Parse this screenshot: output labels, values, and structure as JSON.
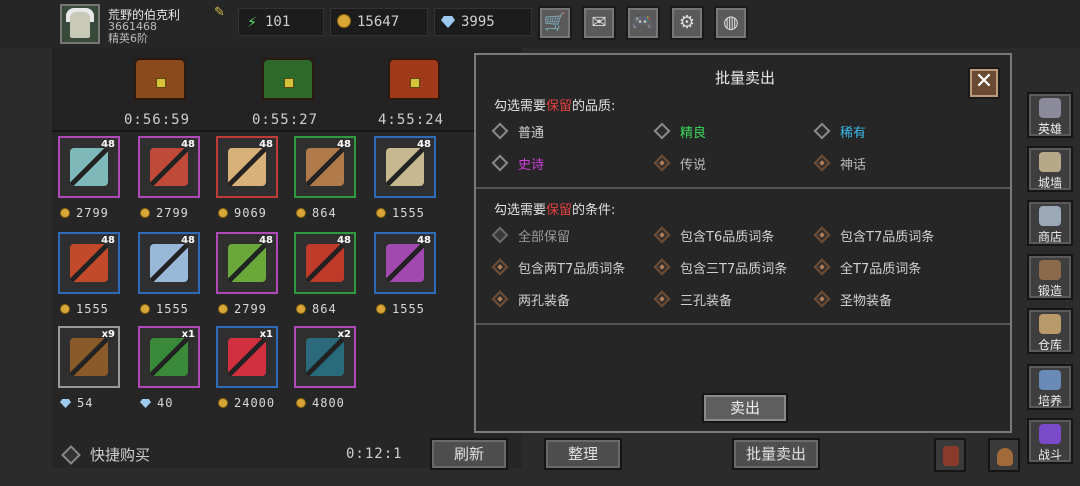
{
  "player": {
    "name": "荒野的伯克利",
    "id": "3661468",
    "rank": "精英6阶"
  },
  "resources": [
    {
      "icon": "energy-icon",
      "value": "101"
    },
    {
      "icon": "gold-coin-icon",
      "value": "15647"
    },
    {
      "icon": "diamond-icon",
      "value": "3995"
    }
  ],
  "top_buttons": [
    {
      "name": "shop-cart-icon",
      "glyph": "🛒"
    },
    {
      "name": "mail-icon",
      "glyph": "✉"
    },
    {
      "name": "gamepad-icon",
      "glyph": "🎮"
    },
    {
      "name": "settings-gear-icon",
      "glyph": "⚙"
    },
    {
      "name": "color-wheel-icon",
      "glyph": "◍"
    }
  ],
  "chests": [
    {
      "time": "0:56:59",
      "color": "#8a4a1c"
    },
    {
      "time": "0:55:27",
      "color": "#2d6a2a"
    },
    {
      "time": "4:55:24",
      "color": "#a03a1a"
    }
  ],
  "items": [
    {
      "qty": "48",
      "price": "2799",
      "currency": "coin",
      "border": "#b04ab8",
      "color": "#7fb8b8"
    },
    {
      "qty": "48",
      "price": "2799",
      "currency": "coin",
      "border": "#b04ab8",
      "color": "#c04a3a"
    },
    {
      "qty": "48",
      "price": "9069",
      "currency": "coin",
      "border": "#c03a3a",
      "color": "#d8b07a"
    },
    {
      "qty": "48",
      "price": "864",
      "currency": "coin",
      "border": "#2e9a3e",
      "color": "#b07a4a"
    },
    {
      "qty": "48",
      "price": "1555",
      "currency": "coin",
      "border": "#2e6ab8",
      "color": "#c8b890"
    },
    {
      "qty": "48",
      "price": "1555",
      "currency": "coin",
      "border": "#2e6ab8",
      "color": "#c04a2a"
    },
    {
      "qty": "48",
      "price": "1555",
      "currency": "coin",
      "border": "#2e6ab8",
      "color": "#9ab8d8"
    },
    {
      "qty": "48",
      "price": "2799",
      "currency": "coin",
      "border": "#b04ab8",
      "color": "#6aa83a"
    },
    {
      "qty": "48",
      "price": "864",
      "currency": "coin",
      "border": "#2e9a3e",
      "color": "#c03a2a"
    },
    {
      "qty": "48",
      "price": "1555",
      "currency": "coin",
      "border": "#2e6ab8",
      "color": "#a04ab0"
    },
    {
      "qty": "x9",
      "price": "54",
      "currency": "gem",
      "border": "#9a9a9a",
      "color": "#8a5a2a"
    },
    {
      "qty": "x1",
      "price": "40",
      "currency": "gem",
      "border": "#b04ab8",
      "color": "#3a8a3a"
    },
    {
      "qty": "x1",
      "price": "24000",
      "currency": "coin",
      "border": "#2e6ab8",
      "color": "#d03040"
    },
    {
      "qty": "x2",
      "price": "4800",
      "currency": "coin",
      "border": "#b04ab8",
      "color": "#2a6a7a"
    }
  ],
  "bottom": {
    "quick_buy": "快捷购买",
    "timer": "0:12:1",
    "refresh": "刷新",
    "sort": "整理",
    "bulk_sell": "批量卖出"
  },
  "modal": {
    "title": "批量卖出",
    "close": "✕",
    "quality_header_pre": "勾选需要",
    "quality_header_red": "保留",
    "quality_header_post": "的品质:",
    "qualities": [
      {
        "label": "普通",
        "color": "#d0d0d0",
        "state": "off"
      },
      {
        "label": "精良",
        "color": "#3ad85a",
        "state": "off"
      },
      {
        "label": "稀有",
        "color": "#3ab8e8",
        "state": "off"
      },
      {
        "label": "史诗",
        "color": "#d040d8",
        "state": "off"
      },
      {
        "label": "传说",
        "color": "#b8b8b8",
        "state": "on"
      },
      {
        "label": "神话",
        "color": "#b8b8b8",
        "state": "on"
      }
    ],
    "cond_header_pre": "勾选需要",
    "cond_header_red": "保留",
    "cond_header_post": "的条件:",
    "conditions": [
      {
        "label": "全部保留",
        "state": "dis"
      },
      {
        "label": "包含T6品质词条",
        "state": "on"
      },
      {
        "label": "包含T7品质词条",
        "state": "on"
      },
      {
        "label": "包含两T7品质词条",
        "state": "on"
      },
      {
        "label": "包含三T7品质词条",
        "state": "on"
      },
      {
        "label": "全T7品质词条",
        "state": "on"
      },
      {
        "label": "两孔装备",
        "state": "on"
      },
      {
        "label": "三孔装备",
        "state": "on"
      },
      {
        "label": "圣物装备",
        "state": "on"
      }
    ],
    "sell": "卖出"
  },
  "side_nav": [
    {
      "label": "英雄",
      "icon": "hero-helmet-icon",
      "color": "#8a8a9a"
    },
    {
      "label": "城墙",
      "icon": "city-wall-icon",
      "color": "#b8a88a"
    },
    {
      "label": "商店",
      "icon": "shop-stall-icon",
      "color": "#9aa8b8"
    },
    {
      "label": "锻造",
      "icon": "anvil-icon",
      "color": "#8a6a4a"
    },
    {
      "label": "仓库",
      "icon": "warehouse-icon",
      "color": "#b89a6a"
    },
    {
      "label": "培养",
      "icon": "training-icon",
      "color": "#6a8ab8"
    },
    {
      "label": "战斗",
      "icon": "battle-portal-icon",
      "color": "#7a4ac8"
    }
  ]
}
